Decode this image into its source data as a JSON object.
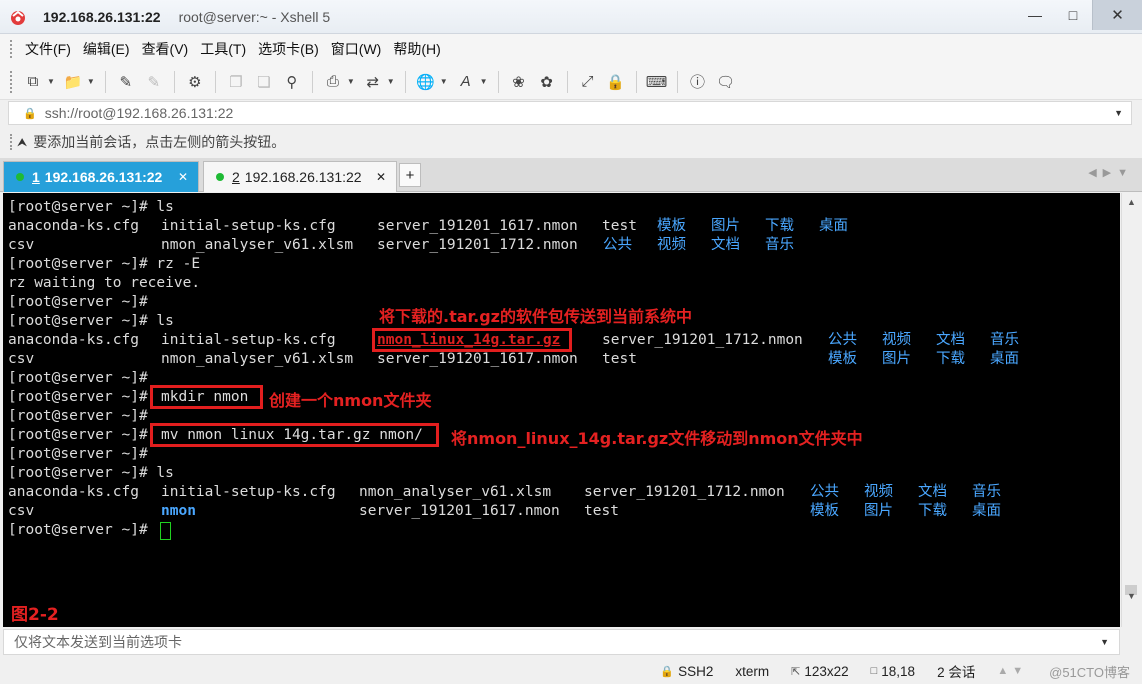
{
  "window": {
    "host": "192.168.26.131:22",
    "title_rest": "root@server:~ - Xshell 5",
    "controls": [
      "minimize",
      "maximize",
      "close"
    ]
  },
  "menu": [
    "文件(F)",
    "编辑(E)",
    "查看(V)",
    "工具(T)",
    "选项卡(B)",
    "窗口(W)",
    "帮助(H)"
  ],
  "toolbar": {
    "icons": [
      "new-session-icon",
      "open-folder-icon",
      "reconnect-icon",
      "disconnect-icon",
      "properties-icon",
      "copy-icon",
      "paste-icon",
      "find-icon",
      "print-icon",
      "transfer-icon",
      "globe-icon",
      "font-icon",
      "xftp-icon",
      "xmanager-icon",
      "fullscreen-icon",
      "lock-icon",
      "keyboard-icon",
      "help-icon",
      "chat-icon"
    ]
  },
  "address": {
    "value": "ssh://root@192.168.26.131:22"
  },
  "hint": {
    "text": "要添加当前会话，点击左侧的箭头按钮。"
  },
  "tabs": [
    {
      "num": "1",
      "label": "192.168.26.131:22",
      "active": true
    },
    {
      "num": "2",
      "label": "192.168.26.131:22",
      "active": false
    }
  ],
  "terminal": {
    "lines": [
      "[root@server ~]# ls",
      "",
      "",
      "[root@server ~]# rz -E",
      "rz waiting to receive.",
      "[root@server ~]#",
      "[root@server ~]# ls",
      "",
      "",
      "[root@server ~]#",
      "[root@server ~]#",
      "[root@server ~]#",
      "[root@server ~]#",
      "[root@server ~]#",
      "[root@server ~]# ls",
      "",
      "",
      "[root@server ~]#"
    ],
    "ls1": {
      "row1": [
        "anaconda-ks.cfg",
        "initial-setup-ks.cfg",
        "server_191201_1617.nmon",
        "test"
      ],
      "row1_dirs": [
        "模板",
        "图片",
        "下载",
        "桌面"
      ],
      "row2": [
        "csv",
        "nmon_analyser_v61.xlsm",
        "server_191201_1712.nmon"
      ],
      "row2_dirs": [
        "公共",
        "视频",
        "文档",
        "音乐"
      ]
    },
    "ls2": {
      "row1": [
        "anaconda-ks.cfg",
        "initial-setup-ks.cfg",
        "nmon_linux_14g.tar.gz",
        "server_191201_1712.nmon"
      ],
      "row1_dirs": [
        "公共",
        "视频",
        "文档",
        "音乐"
      ],
      "row2": [
        "csv",
        "nmon_analyser_v61.xlsm",
        "server_191201_1617.nmon",
        "test"
      ],
      "row2_dirs": [
        "模板",
        "图片",
        "下载",
        "桌面"
      ]
    },
    "cmd_mkdir": "mkdir nmon",
    "cmd_mv": "mv nmon linux 14g.tar.gz nmon/",
    "ls3": {
      "row1": [
        "anaconda-ks.cfg",
        "initial-setup-ks.cfg",
        "nmon_analyser_v61.xlsm",
        "server_191201_1712.nmon"
      ],
      "row1_dirs": [
        "公共",
        "视频",
        "文档",
        "音乐"
      ],
      "row2": [
        "csv",
        "nmon",
        "server_191201_1617.nmon",
        "test"
      ],
      "row2_dirs": [
        "模板",
        "图片",
        "下载",
        "桌面"
      ]
    },
    "annotations": {
      "upload": "将下载的.tar.gz的软件包传送到当前系统中",
      "mkdir": "创建一个nmon文件夹",
      "move": "将nmon_linux_14g.tar.gz文件移动到nmon文件夹中"
    },
    "figure_label": "图2-2"
  },
  "sendbar": {
    "placeholder": "仅将文本发送到当前选项卡"
  },
  "status": {
    "protocol": "SSH2",
    "term": "xterm",
    "size": "123x22",
    "cursor": "18,18",
    "sessions": "2 会话",
    "watermark": "@51CTO博客"
  }
}
